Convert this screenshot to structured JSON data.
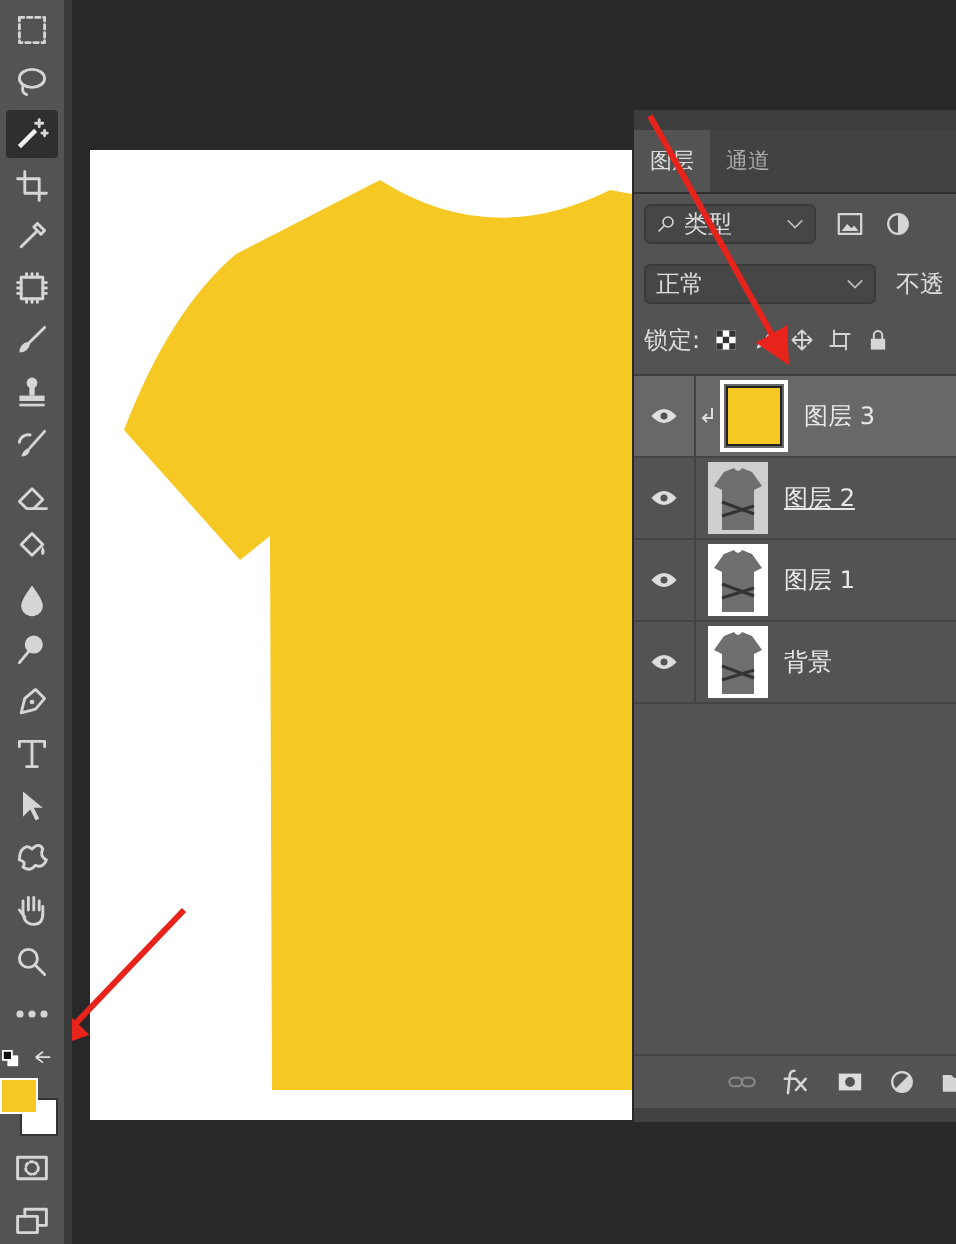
{
  "toolbar": {
    "tools": [
      {
        "kind": "marquee",
        "selected": false
      },
      {
        "kind": "lasso",
        "selected": false
      },
      {
        "kind": "wand",
        "selected": true
      },
      {
        "kind": "crop",
        "selected": false
      },
      {
        "kind": "eyedropper",
        "selected": false
      },
      {
        "kind": "chip",
        "selected": false
      },
      {
        "kind": "brush",
        "selected": false
      },
      {
        "kind": "stamp",
        "selected": false
      },
      {
        "kind": "history",
        "selected": false
      },
      {
        "kind": "eraser",
        "selected": false
      },
      {
        "kind": "bucket",
        "selected": false
      },
      {
        "kind": "drop",
        "selected": false
      },
      {
        "kind": "dodge",
        "selected": false
      },
      {
        "kind": "pen",
        "selected": false
      },
      {
        "kind": "type",
        "selected": false
      },
      {
        "kind": "arrow",
        "selected": false
      },
      {
        "kind": "shape",
        "selected": false
      },
      {
        "kind": "hand",
        "selected": false
      },
      {
        "kind": "zoom",
        "selected": false
      },
      {
        "kind": "more",
        "selected": false
      }
    ],
    "swatches": true
  },
  "layers_panel": {
    "tabs": [
      {
        "label": "图层",
        "selected": true
      },
      {
        "label": "通道",
        "selected": false
      }
    ],
    "filter": {
      "value": "类型"
    },
    "blend_mode": {
      "value": "正常"
    },
    "opacity_label": "不透",
    "lock_label": "锁定:",
    "layers": [
      {
        "name": "图层 3",
        "selected": true,
        "visible": true,
        "clipped": true,
        "clip_base": false,
        "kind": "fill"
      },
      {
        "name": "图层 2",
        "selected": false,
        "visible": true,
        "clipped": false,
        "clip_base": true,
        "kind": "shirt"
      },
      {
        "name": "图层 1",
        "selected": false,
        "visible": true,
        "clipped": false,
        "clip_base": false,
        "kind": "shirt"
      },
      {
        "name": "背景",
        "selected": false,
        "visible": true,
        "clipped": false,
        "clip_base": false,
        "kind": "shirt"
      }
    ]
  }
}
